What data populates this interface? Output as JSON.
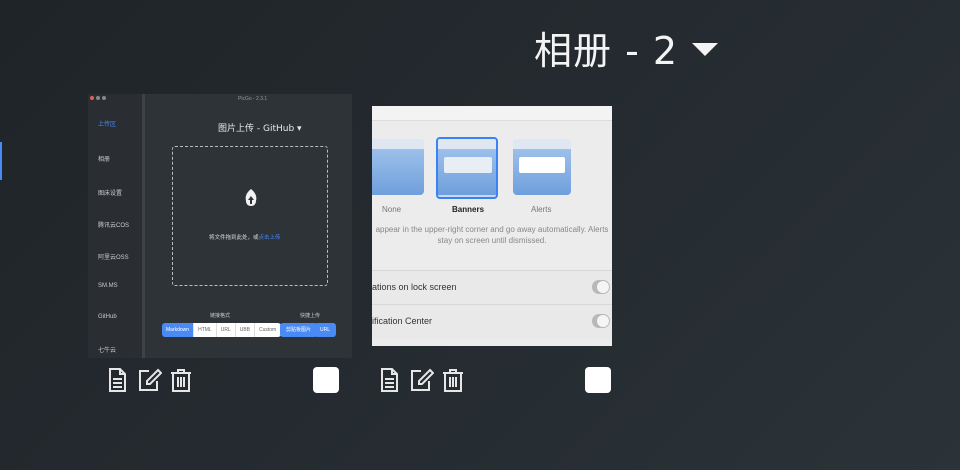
{
  "album": {
    "title": "相册 - 2"
  },
  "cards": [
    {
      "name": "picgo-screenshot",
      "picgo": {
        "version": "PicGo - 2.3.1",
        "main_title": "图片上传 - GitHub ▾",
        "nav": [
          "上传区",
          "相册",
          "图床设置",
          "腾讯云COS",
          "阿里云OSS",
          "SM.MS",
          "GitHub",
          "七牛云"
        ],
        "drop_text": "将文件拖到此处，或",
        "drop_link": "点击上传",
        "link_format_label": "链接格式",
        "formats": [
          "Markdown",
          "HTML",
          "URL",
          "UBB",
          "Custom"
        ],
        "quick_upload_label": "快捷上传",
        "clipboard_button": "剪贴板图片",
        "url_button": "URL"
      }
    },
    {
      "name": "notification-prefs-screenshot",
      "prefs": {
        "styles": [
          "None",
          "Banners",
          "Alerts"
        ],
        "desc_line1": "appear in the upper-right corner and go away automatically. Alerts",
        "desc_line2": "stay on screen until dismissed.",
        "row1": "ations on lock screen",
        "row2": "ification Center"
      }
    }
  ]
}
